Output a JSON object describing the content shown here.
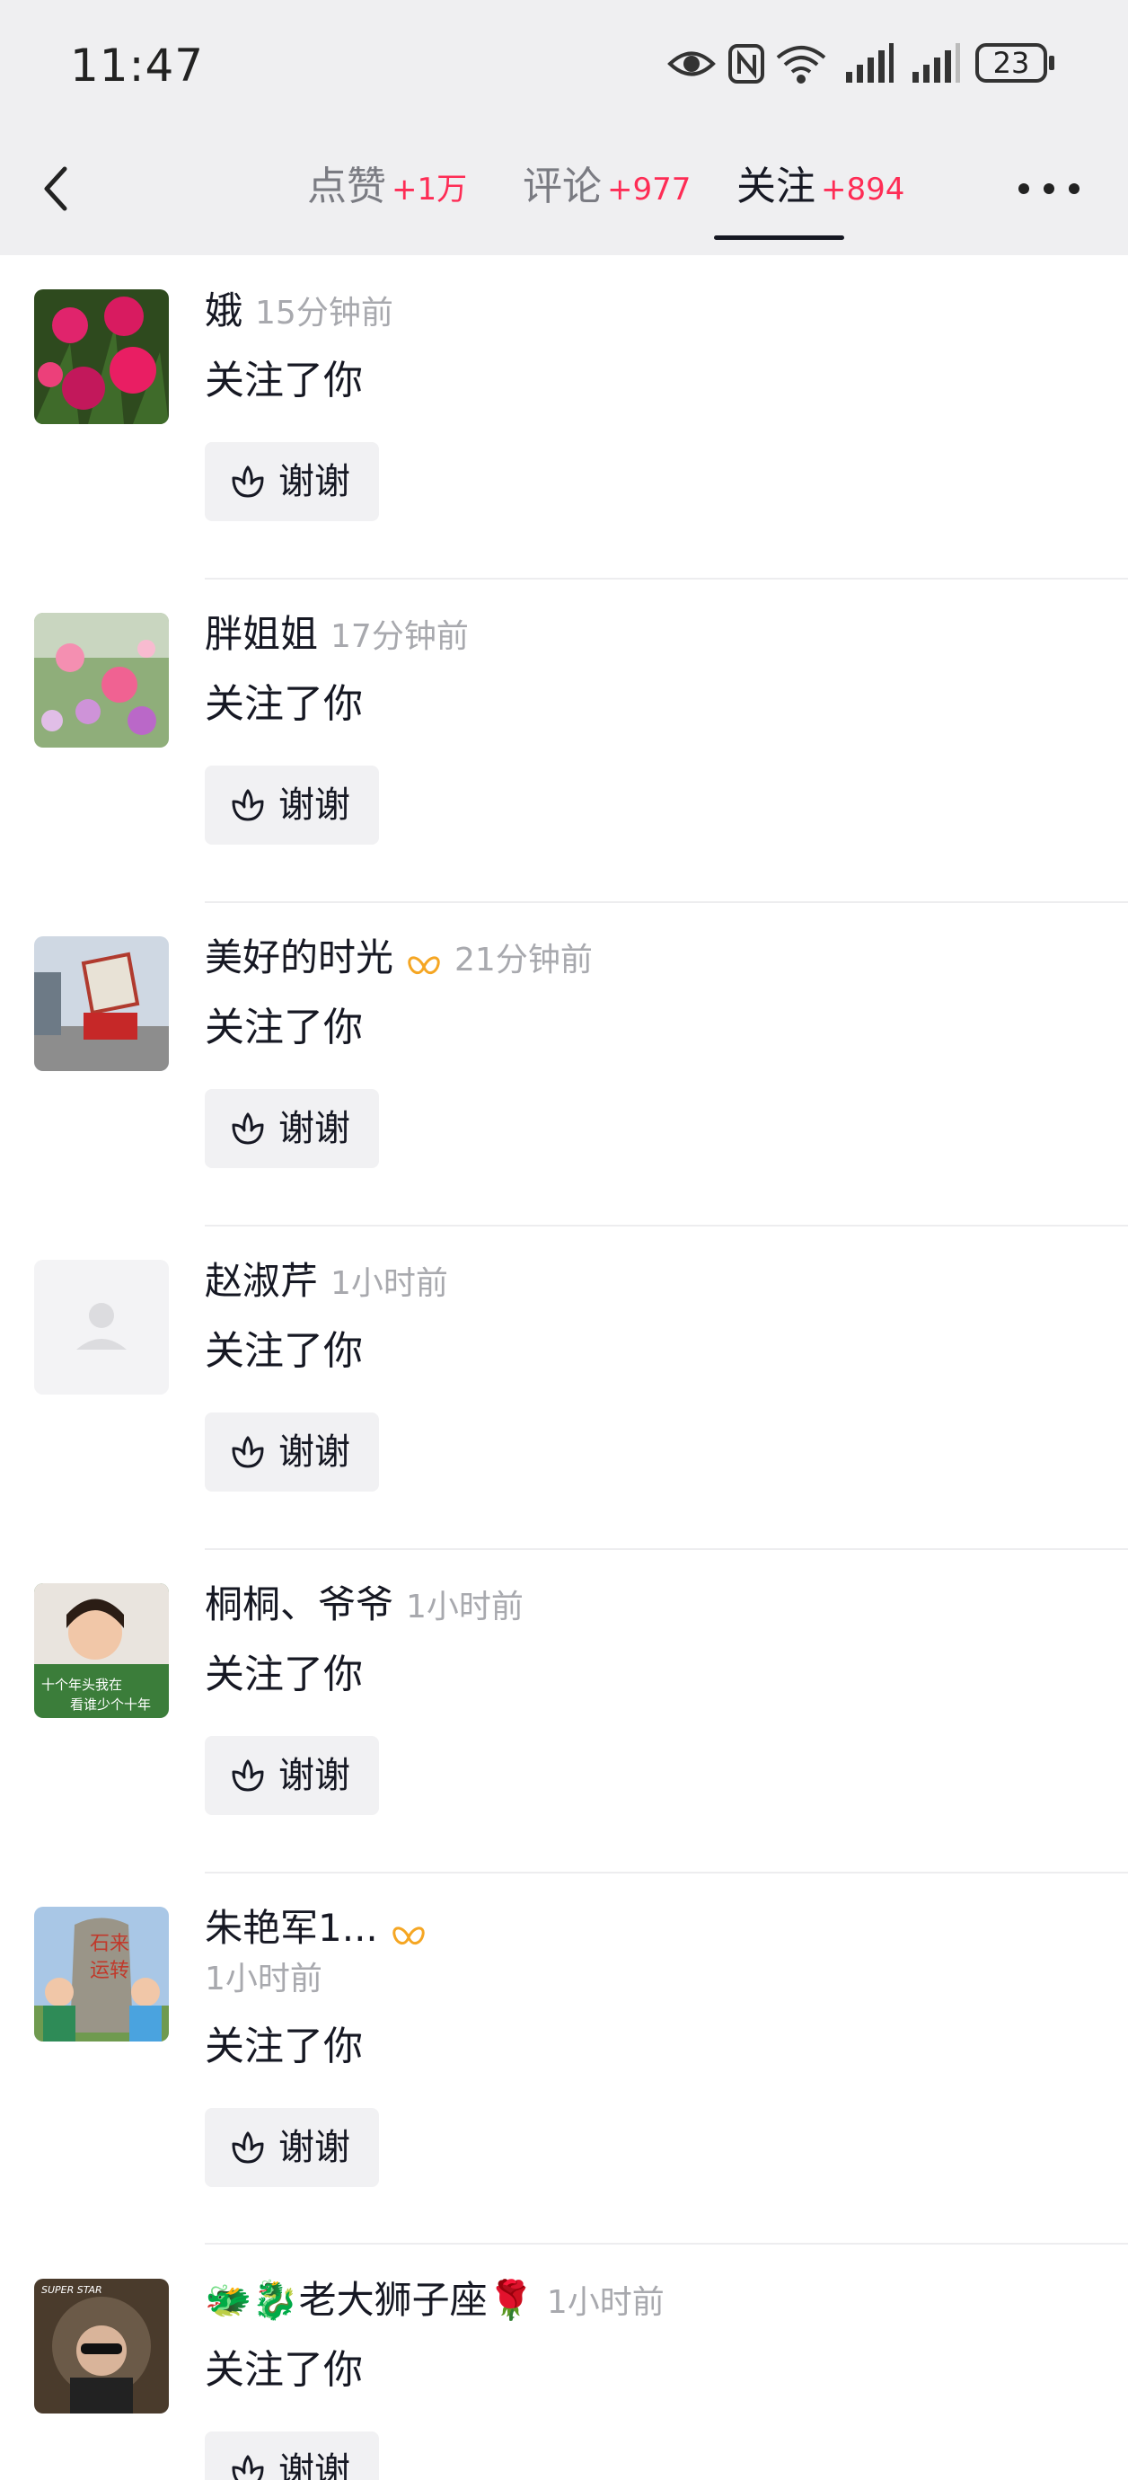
{
  "status_bar": {
    "time": "11:47",
    "battery": "23"
  },
  "tabs": [
    {
      "label": "点赞",
      "count": "+1万"
    },
    {
      "label": "评论",
      "count": "+977"
    },
    {
      "label": "关注",
      "count": "+894"
    }
  ],
  "thanks_label": "谢谢",
  "items": [
    {
      "name": "娥",
      "time": "15分钟前",
      "action": "关注了你"
    },
    {
      "name": "胖姐姐",
      "time": "17分钟前",
      "action": "关注了你"
    },
    {
      "name": "美好的时光",
      "time": "21分钟前",
      "action": "关注了你"
    },
    {
      "name": "赵淑芹",
      "time": "1小时前",
      "action": "关注了你"
    },
    {
      "name": "桐桐、爷爷",
      "time": "1小时前",
      "action": "关注了你"
    },
    {
      "name": "朱艳军1...",
      "time": "1小时前",
      "action": "关注了你"
    },
    {
      "name": "🐲🐉老大狮子座🌹",
      "time": "1小时前",
      "action": "关注了你"
    }
  ],
  "avatar_texts": {
    "item5": "十个年头我在 看谁少个十年",
    "item6": "石来运转",
    "item7": "SUPER STAR"
  },
  "colors": {
    "accent": "#fe2c55",
    "badge": "#f5a623",
    "button_bg": "#f1f1f3"
  }
}
